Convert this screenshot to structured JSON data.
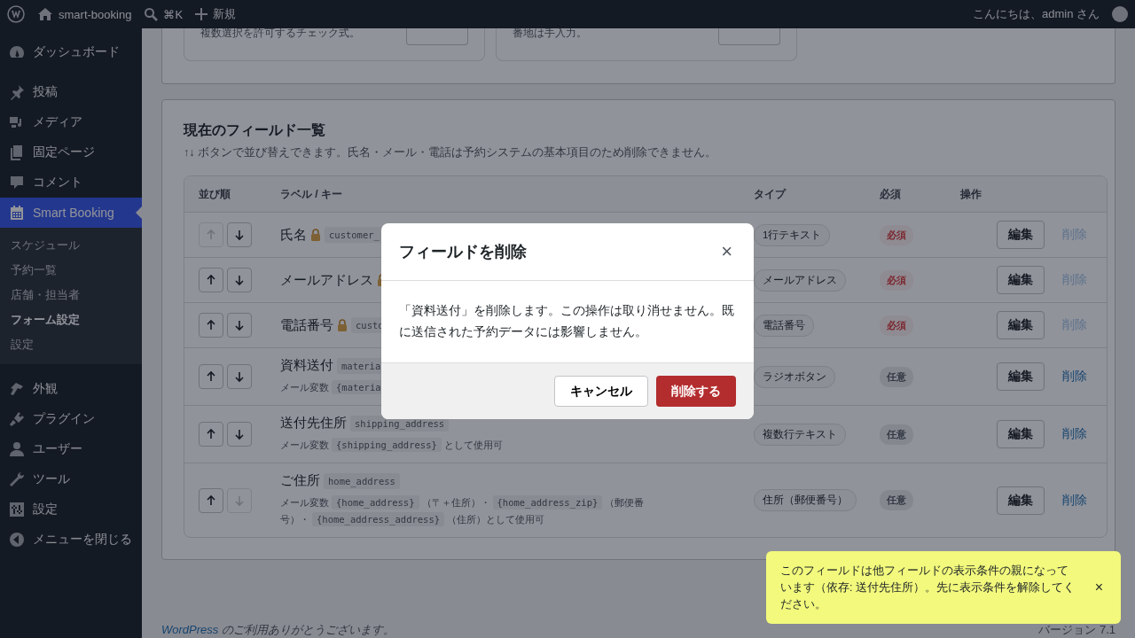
{
  "admin_bar": {
    "site_name": "smart-booking",
    "search_shortcut": "⌘K",
    "new_label": "新規",
    "greeting": "こんにちは、admin さん"
  },
  "sidebar": {
    "groups": [
      {
        "items": [
          {
            "label": "ダッシュボード",
            "selected": false
          }
        ]
      },
      {
        "items": [
          {
            "label": "投稿",
            "selected": false
          },
          {
            "label": "メディア",
            "selected": false
          },
          {
            "label": "固定ページ",
            "selected": false
          },
          {
            "label": "コメント",
            "selected": false
          },
          {
            "label": "Smart Booking",
            "selected": true,
            "children": [
              {
                "label": "スケジュール",
                "selected": false
              },
              {
                "label": "予約一覧",
                "selected": false
              },
              {
                "label": "店舗・担当者",
                "selected": false
              },
              {
                "label": "フォーム設定",
                "selected": true
              },
              {
                "label": "設定",
                "selected": false
              }
            ]
          }
        ]
      },
      {
        "items": [
          {
            "label": "外観",
            "selected": false
          },
          {
            "label": "プラグイン",
            "selected": false
          },
          {
            "label": "ユーザー",
            "selected": false
          },
          {
            "label": "ツール",
            "selected": false
          },
          {
            "label": "設定",
            "selected": false
          },
          {
            "label": "メニューを閉じる",
            "selected": false
          }
        ]
      }
    ]
  },
  "add_field_cards": [
    {
      "description": "複数選択を許可するチェック式。"
    },
    {
      "description": "番地は手入力。"
    }
  ],
  "field_list": {
    "title": "現在のフィールド一覧",
    "subtitle": "↑↓ ボタンで並び替えできます。氏名・メール・電話は予約システムの基本項目のため削除できません。",
    "columns": [
      "並び順",
      "ラベル / キー",
      "タイプ",
      "必須",
      "操作"
    ],
    "rows": [
      {
        "label": "氏名",
        "locked": true,
        "key": "customer_",
        "up_disabled": true,
        "down_disabled": false,
        "type": "1行テキスト",
        "required": true,
        "required_label": "必須",
        "edit_label": "編集",
        "delete_label": "削除",
        "delete_disabled": true
      },
      {
        "label": "メールアドレス",
        "locked": true,
        "up_disabled": false,
        "down_disabled": false,
        "type": "メールアドレス",
        "required": true,
        "required_label": "必須",
        "edit_label": "編集",
        "delete_label": "削除",
        "delete_disabled": true
      },
      {
        "label": "電話番号",
        "locked": true,
        "key": "custo",
        "up_disabled": false,
        "down_disabled": false,
        "type": "電話番号",
        "required": true,
        "required_label": "必須",
        "edit_label": "編集",
        "delete_label": "削除",
        "delete_disabled": true
      },
      {
        "label": "資料送付",
        "locked": false,
        "key": "materia",
        "up_disabled": false,
        "down_disabled": false,
        "mail_vars": [
          {
            "kind": "text",
            "text": "メール変数"
          },
          {
            "kind": "code",
            "text": "{materia"
          }
        ],
        "type": "ラジオボタン",
        "required": false,
        "required_label": "任意",
        "edit_label": "編集",
        "delete_label": "削除",
        "delete_disabled": false
      },
      {
        "label": "送付先住所",
        "locked": false,
        "key": "shipping_address",
        "up_disabled": false,
        "down_disabled": false,
        "mail_vars": [
          {
            "kind": "text",
            "text": "メール変数"
          },
          {
            "kind": "code",
            "text": "{shipping_address}"
          },
          {
            "kind": "text",
            "text": "として使用可"
          }
        ],
        "type": "複数行テキスト",
        "required": false,
        "required_label": "任意",
        "edit_label": "編集",
        "delete_label": "削除",
        "delete_disabled": false
      },
      {
        "label": "ご住所",
        "locked": false,
        "key": "home_address",
        "up_disabled": false,
        "down_disabled": true,
        "mail_vars": [
          {
            "kind": "text",
            "text": "メール変数"
          },
          {
            "kind": "code",
            "text": "{home_address}"
          },
          {
            "kind": "text",
            "text": "（〒＋住所）・"
          },
          {
            "kind": "code",
            "text": "{home_address_zip}"
          },
          {
            "kind": "text",
            "text": "（郵便番号）・"
          },
          {
            "kind": "code",
            "text": "{home_address_address}"
          },
          {
            "kind": "text",
            "text": "（住所）として使用可"
          }
        ],
        "type": "住所（郵便番号）",
        "required": false,
        "required_label": "任意",
        "edit_label": "編集",
        "delete_label": "削除",
        "delete_disabled": false
      }
    ]
  },
  "modal": {
    "title": "フィールドを削除",
    "close": "×",
    "message": "「資料送付」を削除します。この操作は取り消せません。既に送信された予約データには影響しません。",
    "cancel": "キャンセル",
    "confirm": "削除する"
  },
  "toast": {
    "message": "このフィールドは他フィールドの表示条件の親になっています（依存: 送付先住所）。先に表示条件を解除してください。",
    "close": "×"
  },
  "footer": {
    "link": "WordPress",
    "thanks": "のご利用ありがとうございます。",
    "version": "バージョン 7.1"
  }
}
